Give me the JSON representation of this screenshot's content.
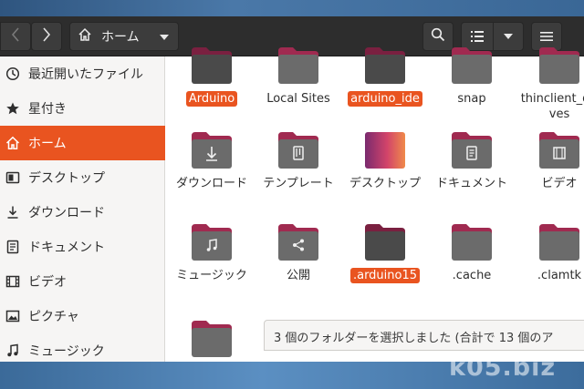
{
  "header": {
    "path_label": "ホーム"
  },
  "sidebar": {
    "items": [
      {
        "label": "最近開いたファイル",
        "icon": "clock-icon",
        "active": false
      },
      {
        "label": "星付き",
        "icon": "star-icon",
        "active": false
      },
      {
        "label": "ホーム",
        "icon": "home-icon",
        "active": true
      },
      {
        "label": "デスクトップ",
        "icon": "desktop-icon",
        "active": false
      },
      {
        "label": "ダウンロード",
        "icon": "download-icon",
        "active": false
      },
      {
        "label": "ドキュメント",
        "icon": "document-icon",
        "active": false
      },
      {
        "label": "ビデオ",
        "icon": "video-icon",
        "active": false
      },
      {
        "label": "ピクチャ",
        "icon": "picture-icon",
        "active": false
      },
      {
        "label": "ミュージック",
        "icon": "music-icon",
        "active": false
      }
    ]
  },
  "files": [
    {
      "name": "Arduino",
      "icon": "folder-icon",
      "selected": true
    },
    {
      "name": "Local Sites",
      "icon": "folder-icon",
      "selected": false
    },
    {
      "name": "arduino_ide",
      "icon": "folder-icon",
      "selected": true
    },
    {
      "name": "snap",
      "icon": "folder-icon",
      "selected": false
    },
    {
      "name": "thinclient_drives",
      "icon": "folder-icon",
      "selected": false
    },
    {
      "name": "ダウンロード",
      "icon": "download-folder-icon",
      "selected": false
    },
    {
      "name": "テンプレート",
      "icon": "template-folder-icon",
      "selected": false
    },
    {
      "name": "デスクトップ",
      "icon": "desktop-folder-icon",
      "selected": false
    },
    {
      "name": "ドキュメント",
      "icon": "document-folder-icon",
      "selected": false
    },
    {
      "name": "ビデオ",
      "icon": "video-folder-icon",
      "selected": false
    },
    {
      "name": "ミュージック",
      "icon": "music-folder-icon",
      "selected": false
    },
    {
      "name": "公開",
      "icon": "share-folder-icon",
      "selected": false
    },
    {
      "name": ".arduino15",
      "icon": "folder-icon",
      "selected": true
    },
    {
      "name": ".cache",
      "icon": "folder-icon",
      "selected": false
    },
    {
      "name": ".clamtk",
      "icon": "folder-icon",
      "selected": false
    },
    {
      "name": "",
      "icon": "folder-icon",
      "selected": false
    }
  ],
  "status": {
    "text": "3 個のフォルダーを選択しました (合計で 13 個のア"
  },
  "watermark": "k05.biz",
  "colors": {
    "accent": "#e95420",
    "folder_body": "#6b6b6b",
    "folder_tab": "#a02a50",
    "selected_folder_body": "#4a4a4a"
  }
}
